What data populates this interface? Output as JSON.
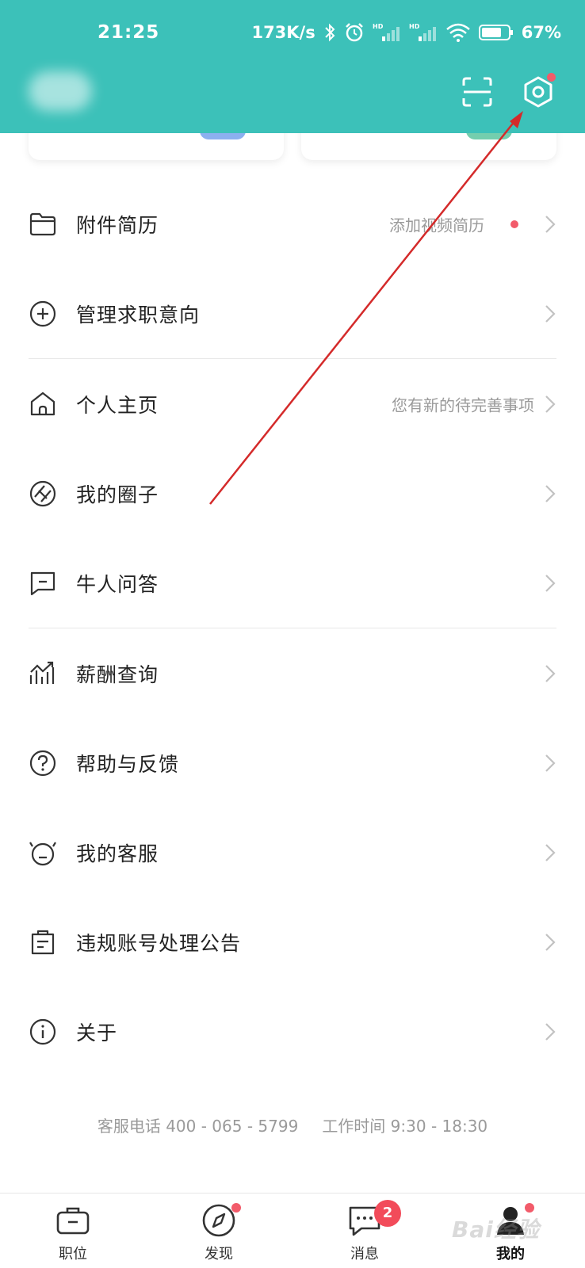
{
  "status_bar": {
    "time": "21:25",
    "speed": "173K/s",
    "battery": "67%"
  },
  "header": {
    "scan_icon": "scan-icon",
    "settings_icon": "gear-icon"
  },
  "menu": [
    {
      "label": "附件简历",
      "hint": "添加视频简历",
      "dot": true,
      "icon": "folder-icon"
    },
    {
      "label": "管理求职意向",
      "hint": "",
      "dot": false,
      "icon": "plus-circle-icon"
    },
    {
      "label": "个人主页",
      "hint": "您有新的待完善事项",
      "dot": false,
      "icon": "home-icon"
    },
    {
      "label": "我的圈子",
      "hint": "",
      "dot": false,
      "icon": "circle-icon"
    },
    {
      "label": "牛人问答",
      "hint": "",
      "dot": false,
      "icon": "chat-icon"
    },
    {
      "label": "薪酬查询",
      "hint": "",
      "dot": false,
      "icon": "chart-icon"
    },
    {
      "label": "帮助与反馈",
      "hint": "",
      "dot": false,
      "icon": "help-icon"
    },
    {
      "label": "我的客服",
      "hint": "",
      "dot": false,
      "icon": "service-icon"
    },
    {
      "label": "违规账号处理公告",
      "hint": "",
      "dot": false,
      "icon": "notice-icon"
    },
    {
      "label": "关于",
      "hint": "",
      "dot": false,
      "icon": "info-icon"
    }
  ],
  "footer": {
    "phone": "客服电话 400 - 065 - 5799",
    "hours": "工作时间 9:30 - 18:30"
  },
  "tabbar": [
    {
      "label": "职位",
      "icon": "briefcase-icon"
    },
    {
      "label": "发现",
      "icon": "compass-icon",
      "dot": true
    },
    {
      "label": "消息",
      "icon": "message-icon",
      "badge": "2"
    },
    {
      "label": "我的",
      "icon": "profile-icon",
      "dot": true,
      "active": true
    }
  ],
  "watermark": "Bai经验",
  "colors": {
    "header": "#3cc1b9",
    "red_dot": "#f25b6a",
    "arrow": "#d42a2a"
  }
}
